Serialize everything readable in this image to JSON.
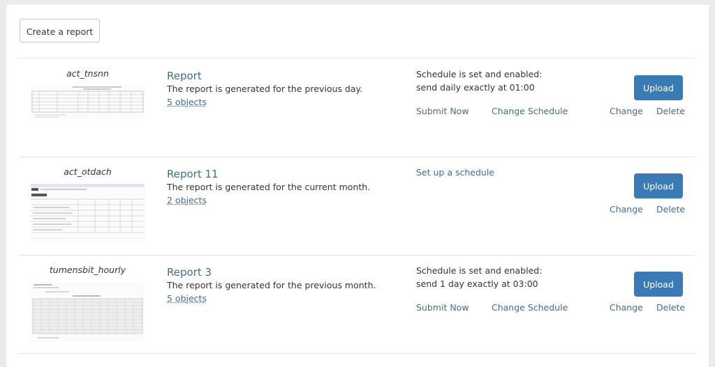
{
  "toolbar": {
    "create_label": "Create a report"
  },
  "reports": [
    {
      "name": "act_tnsnn",
      "title": "Report",
      "description": "The report is generated for the previous day.",
      "objects": "5 objects",
      "schedule_line1": "Schedule is set and enabled:",
      "schedule_line2": "send daily exactly at 01:00",
      "submit_now": "Submit Now",
      "change_schedule": "Change Schedule",
      "upload": "Upload",
      "change": "Change",
      "delete": "Delete"
    },
    {
      "name": "act_otdach",
      "title": "Report 11",
      "description": "The report is generated for the current month.",
      "objects": "2 objects",
      "setup_schedule": "Set up a schedule",
      "upload": "Upload",
      "change": "Change",
      "delete": "Delete"
    },
    {
      "name": "tumensbit_hourly",
      "title": "Report 3",
      "description": "The report is generated for the previous month.",
      "objects": "5 objects",
      "schedule_line1": "Schedule is set and enabled:",
      "schedule_line2": "send 1 day exactly at 03:00",
      "submit_now": "Submit Now",
      "change_schedule": "Change Schedule",
      "upload": "Upload",
      "change": "Change",
      "delete": "Delete"
    }
  ],
  "colors": {
    "link": "#3f6d8e",
    "accent": "#3a7bb6",
    "background": "#ebebeb"
  }
}
